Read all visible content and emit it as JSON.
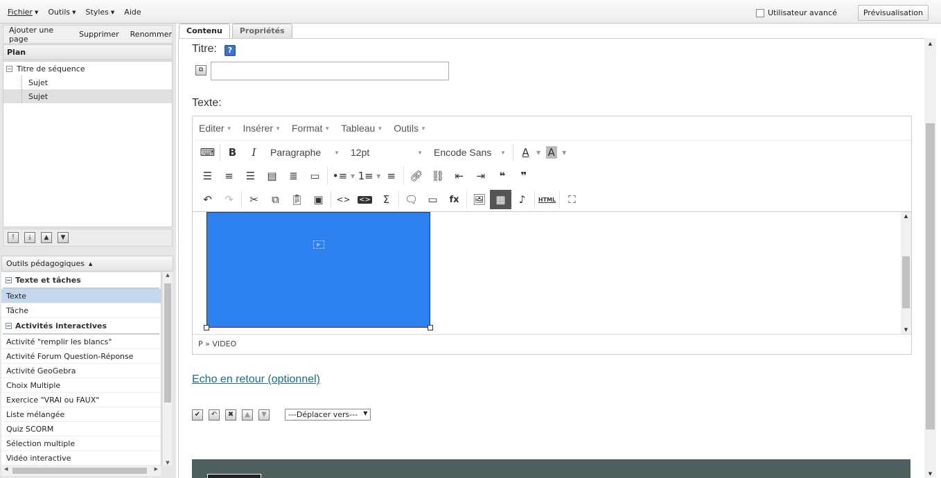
{
  "menubar": {
    "items": [
      {
        "label": "Fichier",
        "has_caret": true
      },
      {
        "label": "Outils",
        "has_caret": true
      },
      {
        "label": "Styles",
        "has_caret": true
      },
      {
        "label": "Aide",
        "has_caret": false
      }
    ],
    "advanced_user_label": "Utilisateur avancé",
    "advanced_user_checked": false,
    "preview_label": "Prévisualisation"
  },
  "pagebar": {
    "add": "Ajouter une page",
    "delete": "Supprimer",
    "rename": "Renommer"
  },
  "plan": {
    "header": "Plan",
    "root": "Titre de séquence",
    "children": [
      "Sujet",
      "Sujet"
    ],
    "selected_index": 1
  },
  "tools": {
    "header": "Outils pédagogiques",
    "sections": [
      {
        "title": "Texte et tâches",
        "items": [
          "Texte",
          "Tâche"
        ]
      },
      {
        "title": "Activités interactives",
        "items": [
          "Activité \"remplir les blancs\"",
          "Activité Forum Question-Réponse",
          "Activité GeoGebra",
          "Choix Multiple",
          "Exercice \"VRAI ou FAUX\"",
          "Liste mélangée",
          "Quiz SCORM",
          "Sélection multiple",
          "Vidéo interactive"
        ]
      }
    ],
    "active_item": "Texte"
  },
  "tabs": [
    {
      "label": "Contenu",
      "active": true
    },
    {
      "label": "Propriétés",
      "active": false
    }
  ],
  "form": {
    "title_label": "Titre:",
    "title_value": "",
    "text_label": "Texte:",
    "feedback_link": "Echo en retour (optionnel)",
    "move_select": "---Déplacer vers---"
  },
  "editor": {
    "menu": [
      "Editer",
      "Insérer",
      "Format",
      "Tableau",
      "Outils"
    ],
    "block_format": "Paragraphe",
    "font_size": "12pt",
    "font_family": "Encode Sans",
    "status_path": "P » VIDEO",
    "video_color": "#2e82f0"
  }
}
